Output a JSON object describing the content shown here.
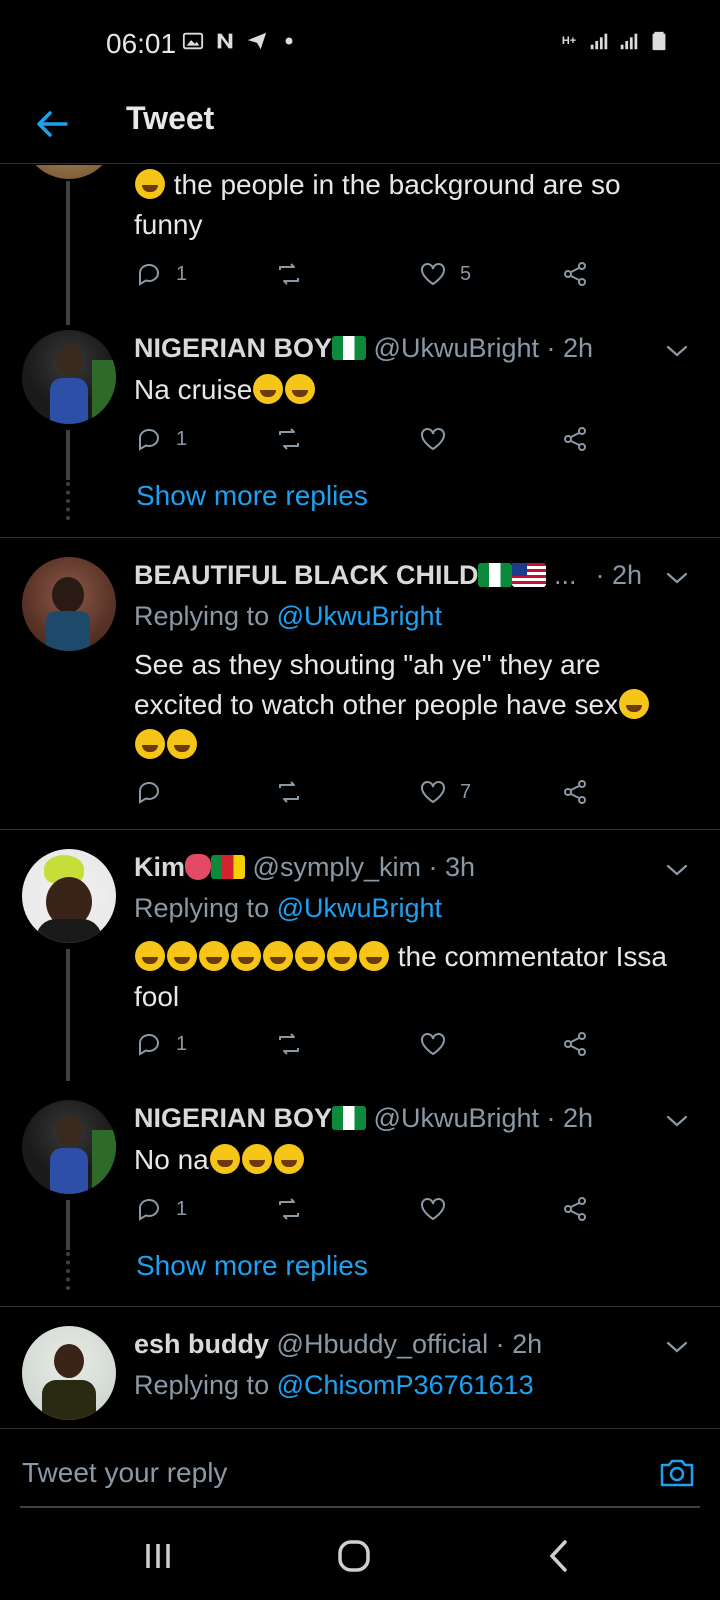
{
  "status_bar": {
    "time": "06:01",
    "left_icons": [
      "image-icon",
      "n-icon",
      "telegram-icon",
      "dot-icon"
    ],
    "right_icons": [
      "h-plus-icon",
      "signal-icon",
      "signal-icon",
      "battery-icon"
    ]
  },
  "app_bar": {
    "title": "Tweet",
    "back_icon": "arrow-left-icon"
  },
  "colors": {
    "accent": "#1da1f2",
    "background": "#000000",
    "muted": "#8b98a5",
    "divider": "#2f3336"
  },
  "tweets": [
    {
      "body": "the people in the background are so funny",
      "reply_count": "1",
      "like_count": "5"
    },
    {
      "name": "NIGERIAN BOY",
      "handle": "@UkwuBright",
      "time": "· 2h",
      "body": "Na cruise",
      "reply_count": "1",
      "like_count": "",
      "show_more": "Show more replies"
    },
    {
      "name": "BEAUTIFUL BLACK CHILD",
      "ellipsis": "...",
      "time": "· 2h",
      "replying_prefix": "Replying to",
      "replying_to": "@UkwuBright",
      "body": "See as they shouting \"ah ye\" they are excited to watch other people have sex",
      "reply_count": "",
      "like_count": "7"
    },
    {
      "name": "Kim",
      "handle": "@symply_kim",
      "time": "· 3h",
      "replying_prefix": "Replying to",
      "replying_to": "@UkwuBright",
      "body": "the commentator Issa fool",
      "reply_count": "1",
      "like_count": ""
    },
    {
      "name": "NIGERIAN BOY",
      "handle": "@UkwuBright",
      "time": "· 2h",
      "body": "No na",
      "reply_count": "1",
      "like_count": "",
      "show_more": "Show more replies"
    },
    {
      "name": "esh buddy",
      "handle": "@Hbuddy_official",
      "time": "· 2h",
      "replying_prefix": "Replying to",
      "replying_to": "@ChisomP36761613"
    }
  ],
  "composer": {
    "placeholder": "Tweet your reply",
    "camera_icon": "camera-icon"
  },
  "nav_bar": {
    "icons": [
      "recents-icon",
      "home-icon",
      "back-icon"
    ]
  }
}
